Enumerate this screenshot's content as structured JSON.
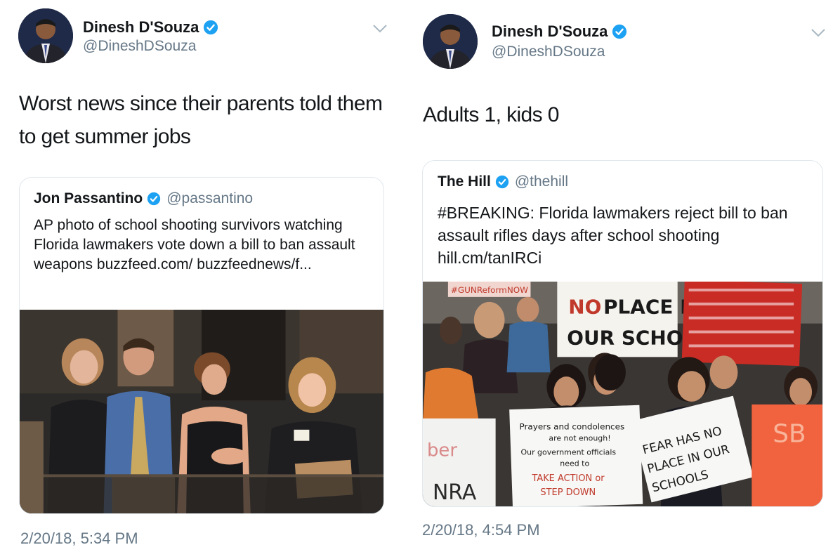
{
  "left_tweet": {
    "author_name": "Dinesh D'Souza",
    "author_handle": "@DineshDSouza",
    "text": "Worst news since their parents told them to get summer jobs",
    "timestamp": "2/20/18, 5:34 PM",
    "quoted": {
      "author_name": "Jon Passantino",
      "author_handle": "@passantino",
      "text": "AP photo of school shooting survivors watching Florida lawmakers vote down a bill to ban assault weapons buzzfeed.com/ buzzfeednews/f..."
    }
  },
  "right_tweet": {
    "author_name": "Dinesh D'Souza",
    "author_handle": "@DineshDSouza",
    "text": "Adults 1, kids 0",
    "timestamp": "2/20/18, 4:54 PM",
    "quoted": {
      "author_name": "The Hill",
      "author_handle": "@thehill",
      "text": "#BREAKING: Florida lawmakers reject bill to ban assault rifles days after school shooting hill.cm/tanIRCi"
    },
    "photo_signs": {
      "sign_1": "NO PLACE IN OUR SCHOOLS",
      "sign_2_l1": "Prayers and condolences",
      "sign_2_l2": "are not enough!",
      "sign_2_l3": "Our government officials",
      "sign_2_l4": "need to",
      "sign_2_l5": "TAKE ACTION or",
      "sign_2_l6": "STEP DOWN",
      "sign_3_l1": "FEAR HAS NO",
      "sign_3_l2": "PLACE IN OUR",
      "sign_3_l3": "SCHOOLS",
      "sign_4": "NRA",
      "sign_5": "#GUNReformNOW"
    }
  },
  "colors": {
    "verified_blue": "#1da1f2",
    "secondary_text": "#657786",
    "border": "#e1e8ed"
  },
  "icons": {
    "verified": "verified-badge-icon",
    "menu": "chevron-down-icon"
  }
}
